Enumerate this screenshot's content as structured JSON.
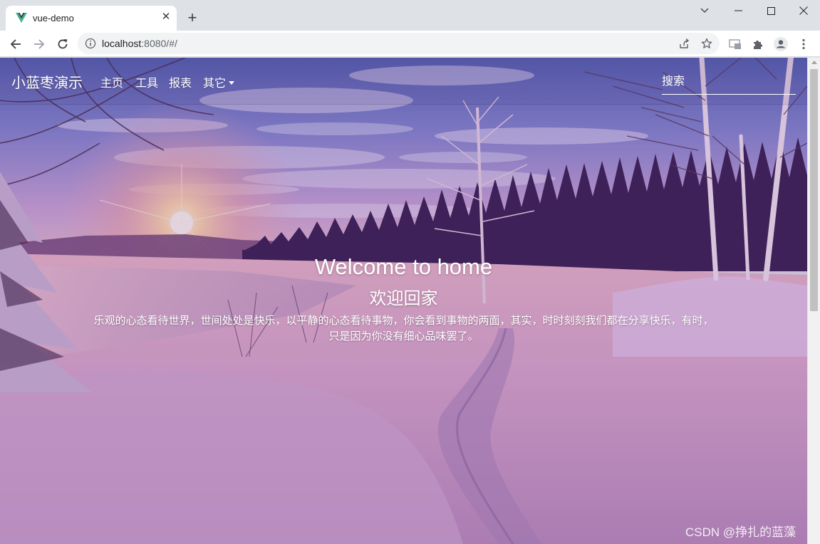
{
  "browser": {
    "tab_title": "vue-demo",
    "url_host": "localhost",
    "url_path": ":8080/#/",
    "icons": [
      "vue-logo-icon",
      "close-icon",
      "plus-icon",
      "chevron-down-icon",
      "minimize-icon",
      "maximize-icon",
      "close-window-icon",
      "back-arrow-icon",
      "forward-arrow-icon",
      "reload-icon",
      "info-icon",
      "share-icon",
      "star-icon",
      "media-icon",
      "puzzle-icon",
      "profile-icon",
      "kebab-menu-icon"
    ]
  },
  "navbar": {
    "brand": "小蓝枣演示",
    "items": [
      {
        "label": "主页"
      },
      {
        "label": "工具"
      },
      {
        "label": "报表"
      },
      {
        "label": "其它"
      }
    ],
    "search_placeholder": "搜索"
  },
  "hero": {
    "title": "Welcome to home",
    "subtitle": "欢迎回家",
    "text_line1": "乐观的心态看待世界，世间处处是快乐，以平静的心态看待事物，你会看到事物的两面，其实，时时刻刻我们都在分享快乐，有时，",
    "text_line2": "只是因为你没有细心品味罢了。"
  },
  "watermark": "CSDN @挣扎的蓝藻",
  "colors": {
    "overlay": "#7a4f9e",
    "chrome_bg": "#dee1e6",
    "vue_green": "#41b883",
    "vue_dark": "#34495e"
  }
}
